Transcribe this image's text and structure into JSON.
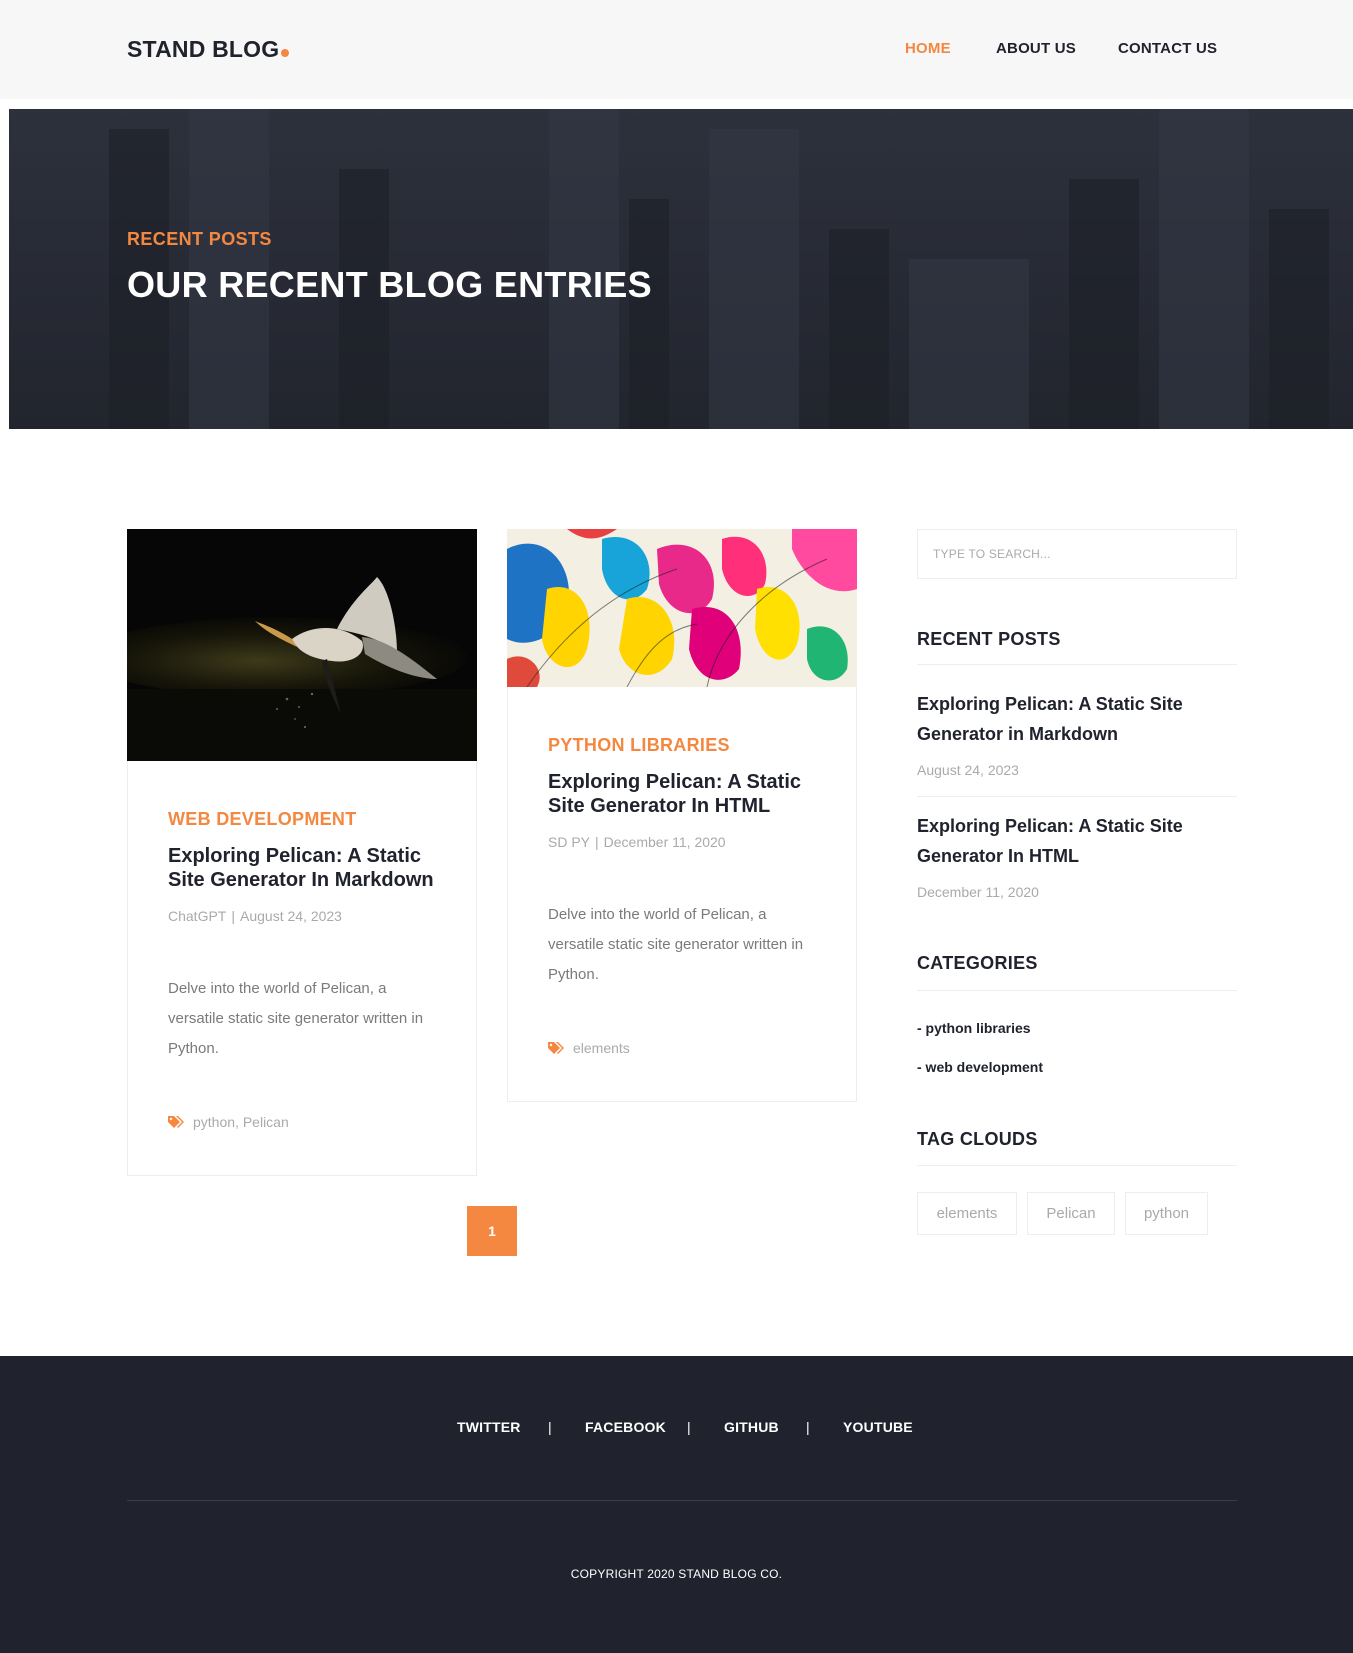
{
  "header": {
    "logo": "STAND BLOG",
    "nav": [
      {
        "label": "HOME",
        "active": true
      },
      {
        "label": "ABOUT US",
        "active": false
      },
      {
        "label": "CONTACT US",
        "active": false
      }
    ]
  },
  "hero": {
    "subtitle": "RECENT POSTS",
    "title": "OUR RECENT BLOG ENTRIES"
  },
  "posts": [
    {
      "category": "WEB DEVELOPMENT",
      "title": "Exploring Pelican: A Static Site Generator In Markdown",
      "author": "ChatGPT",
      "date": "August 24, 2023",
      "excerpt": "Delve into the world of Pelican, a versatile static site generator written in Python.",
      "tags": [
        "python",
        "Pelican"
      ]
    },
    {
      "category": "PYTHON LIBRARIES",
      "title": "Exploring Pelican: A Static Site Generator In HTML",
      "author": "SD PY",
      "date": "December 11, 2020",
      "excerpt": "Delve into the world of Pelican, a versatile static site generator written in Python.",
      "tags": [
        "elements"
      ]
    }
  ],
  "pagination": {
    "current": "1"
  },
  "sidebar": {
    "search_placeholder": "TYPE TO SEARCH...",
    "recent_posts_heading": "RECENT POSTS",
    "recent_posts": [
      {
        "title": "Exploring Pelican: A Static Site Generator in Markdown",
        "date": "August 24, 2023"
      },
      {
        "title": "Exploring Pelican: A Static Site Generator In HTML",
        "date": "December 11, 2020"
      }
    ],
    "categories_heading": "CATEGORIES",
    "categories": [
      "- python libraries",
      "- web development"
    ],
    "tag_clouds_heading": "TAG CLOUDS",
    "tags": [
      "elements",
      "Pelican",
      "python"
    ]
  },
  "footer": {
    "social": [
      "TWITTER",
      "FACEBOOK",
      "GITHUB",
      "YOUTUBE"
    ],
    "separator": "|",
    "copyright": "COPYRIGHT 2020 STAND BLOG CO."
  },
  "colors": {
    "accent": "#f48840",
    "dark": "#20232e",
    "muted": "#aaaaaa"
  }
}
